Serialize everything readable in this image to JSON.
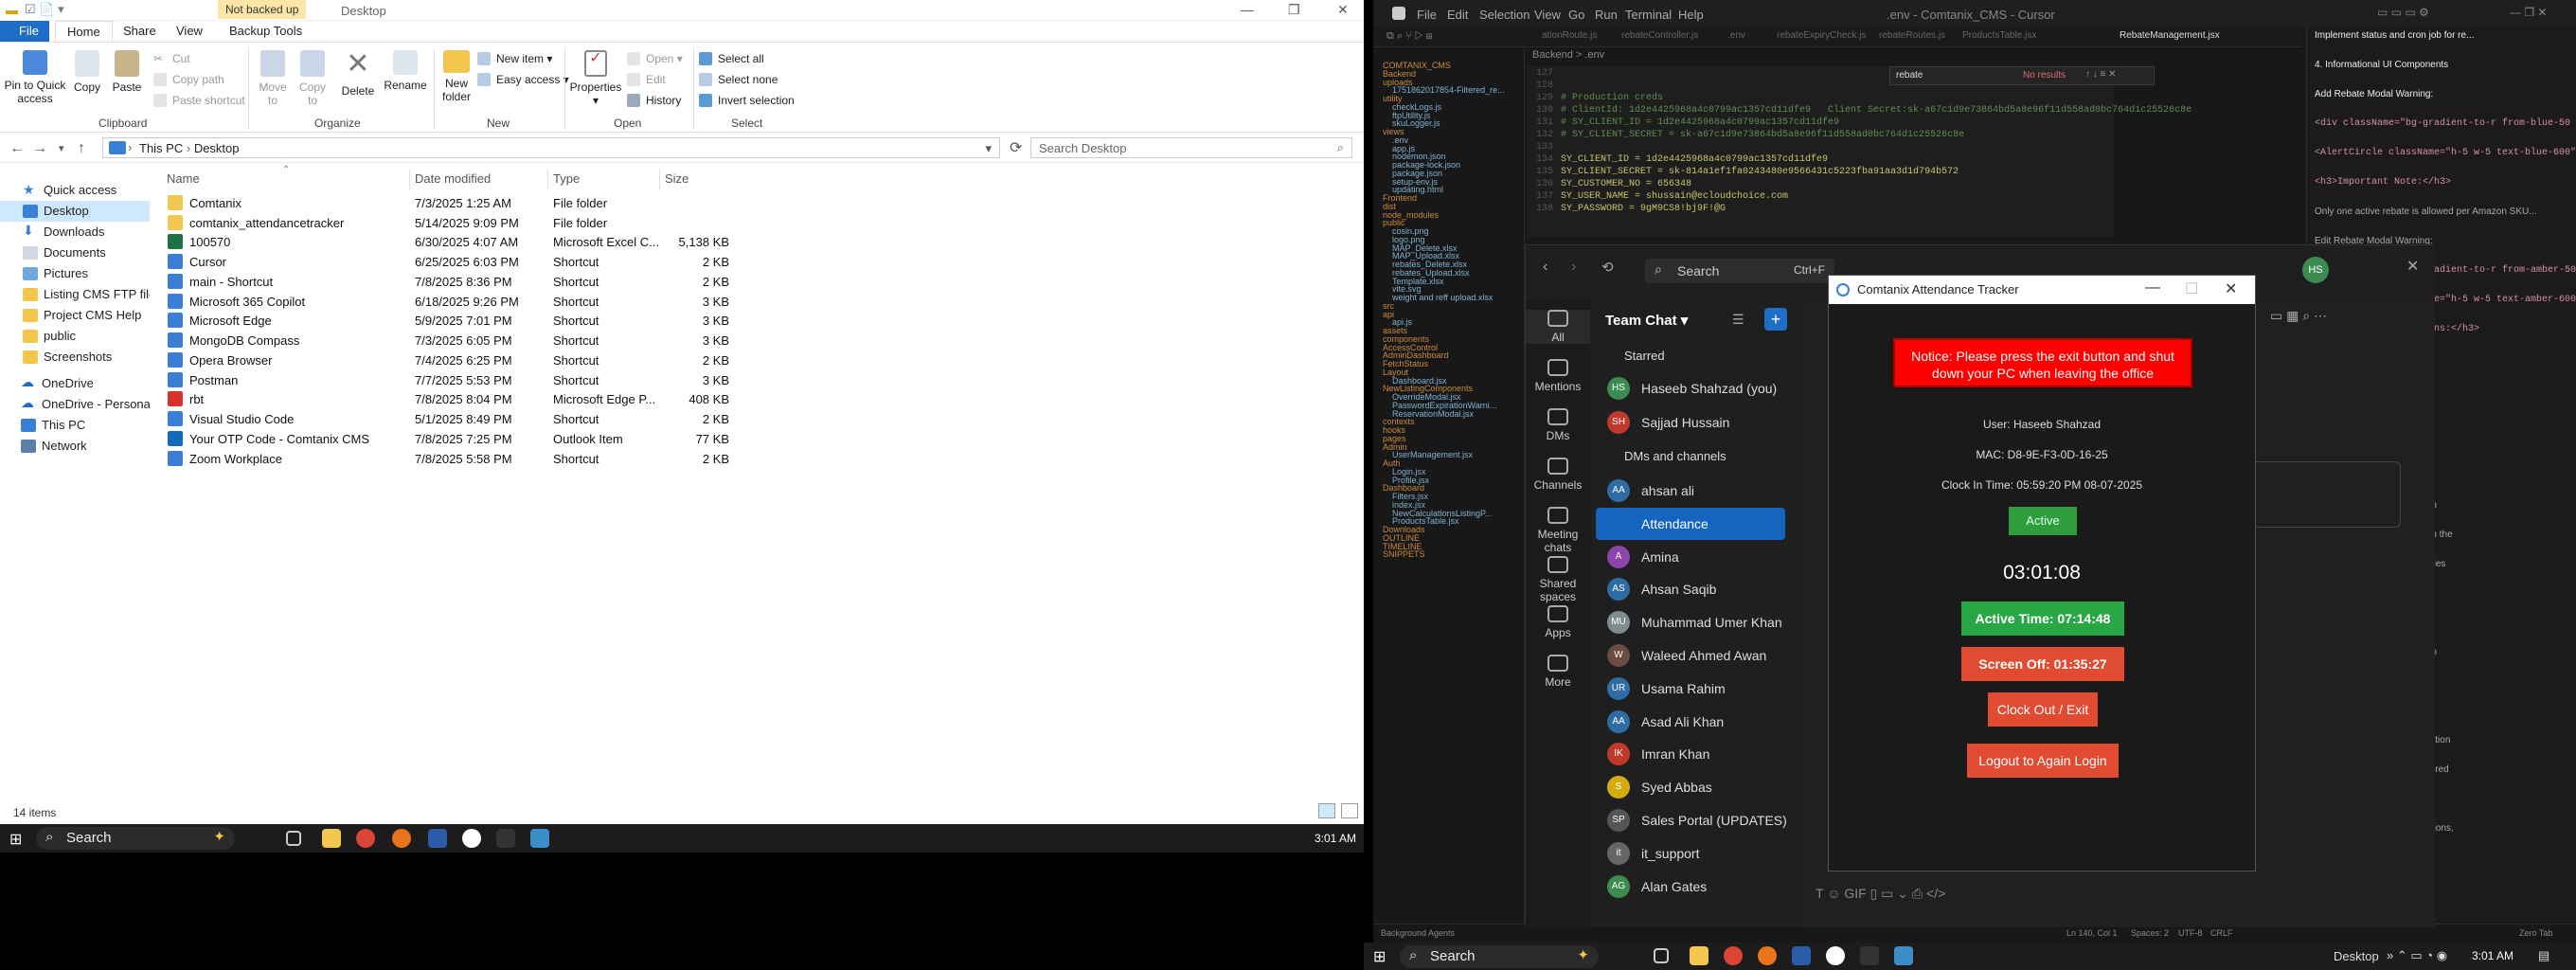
{
  "explorer": {
    "not_backed_up": "Not backed up",
    "title": "Desktop",
    "tabs": [
      "File",
      "Home",
      "Share",
      "View",
      "Backup Tools"
    ],
    "ribbon": {
      "pin": "Pin to Quick access",
      "copy": "Copy",
      "paste": "Paste",
      "cut": "Cut",
      "copy_path": "Copy path",
      "paste_shortcut": "Paste shortcut",
      "move_to": "Move to",
      "copy_to": "Copy to",
      "delete": "Delete",
      "rename": "Rename",
      "new_folder": "New folder",
      "new_item": "New item",
      "easy_access": "Easy access",
      "properties": "Properties",
      "open": "Open",
      "edit": "Edit",
      "history": "History",
      "select_all": "Select all",
      "select_none": "Select none",
      "invert_selection": "Invert selection",
      "groups": [
        "Clipboard",
        "Organize",
        "New",
        "Open",
        "Select"
      ]
    },
    "address": {
      "this_pc": "This PC",
      "desktop": "Desktop",
      "search_placeholder": "Search Desktop"
    },
    "nav": [
      "Quick access",
      "Desktop",
      "Downloads",
      "Documents",
      "Pictures",
      "Listing CMS FTP file",
      "Project CMS Help",
      "public",
      "Screenshots",
      "OneDrive",
      "OneDrive - Personal",
      "This PC",
      "Network"
    ],
    "columns": [
      "Name",
      "Date modified",
      "Type",
      "Size"
    ],
    "files": [
      {
        "name": "Comtanix",
        "date": "7/3/2025 1:25 AM",
        "type": "File folder",
        "size": ""
      },
      {
        "name": "comtanix_attendancetracker",
        "date": "5/14/2025 9:09 PM",
        "type": "File folder",
        "size": ""
      },
      {
        "name": "100570",
        "date": "6/30/2025 4:07 AM",
        "type": "Microsoft Excel C...",
        "size": "5,138 KB"
      },
      {
        "name": "Cursor",
        "date": "6/25/2025 6:03 PM",
        "type": "Shortcut",
        "size": "2 KB"
      },
      {
        "name": "main - Shortcut",
        "date": "7/8/2025 8:36 PM",
        "type": "Shortcut",
        "size": "2 KB"
      },
      {
        "name": "Microsoft 365 Copilot",
        "date": "6/18/2025 9:26 PM",
        "type": "Shortcut",
        "size": "3 KB"
      },
      {
        "name": "Microsoft Edge",
        "date": "5/9/2025 7:01 PM",
        "type": "Shortcut",
        "size": "3 KB"
      },
      {
        "name": "MongoDB Compass",
        "date": "7/3/2025 6:05 PM",
        "type": "Shortcut",
        "size": "3 KB"
      },
      {
        "name": "Opera Browser",
        "date": "7/4/2025 6:25 PM",
        "type": "Shortcut",
        "size": "2 KB"
      },
      {
        "name": "Postman",
        "date": "7/7/2025 5:53 PM",
        "type": "Shortcut",
        "size": "3 KB"
      },
      {
        "name": "rbt",
        "date": "7/8/2025 8:04 PM",
        "type": "Microsoft Edge P...",
        "size": "408 KB"
      },
      {
        "name": "Visual Studio Code",
        "date": "5/1/2025 8:49 PM",
        "type": "Shortcut",
        "size": "2 KB"
      },
      {
        "name": "Your OTP Code - Comtanix CMS",
        "date": "7/8/2025 7:25 PM",
        "type": "Outlook Item",
        "size": "77 KB"
      },
      {
        "name": "Zoom Workplace",
        "date": "7/8/2025 5:58 PM",
        "type": "Shortcut",
        "size": "2 KB"
      }
    ],
    "status": "14 items"
  },
  "taskbar_left": {
    "search": "Search",
    "time": "3:01 AM"
  },
  "ide": {
    "menu": [
      "File",
      "Edit",
      "Selection",
      "View",
      "Go",
      "Run",
      "Terminal",
      "Help"
    ],
    "title": ".env - Comtanix_CMS - Cursor",
    "tabs": [
      "ationRoute.js",
      "rebateController.js",
      ".env",
      "rebateExpiryCheck.js",
      "rebateRoutes.js",
      "ProductsTable.jsx",
      "RebateManagement.jsx"
    ],
    "breadcrumb": "Backend > .env",
    "find_text": "rebate",
    "find_result": "No results",
    "code": [
      {
        "n": "127",
        "t": ""
      },
      {
        "n": "128",
        "t": ""
      },
      {
        "n": "129",
        "t": "# Production creds"
      },
      {
        "n": "130",
        "t": "# ClientId: 1d2e4425968a4c0799ac1357cd11dfe9   Client Secret:sk-a67c1d9e73864bd5a8e96f11d558ad0bc764d1c25526c8e"
      },
      {
        "n": "131",
        "t": "# SY_CLIENT_ID = 1d2e4425968a4c0799ac1357cd11dfe9"
      },
      {
        "n": "132",
        "t": "# SY_CLIENT_SECRET = sk-a67c1d9e73864bd5a8e96f11d558ad0bc764d1c25526c8e"
      },
      {
        "n": "133",
        "t": ""
      },
      {
        "n": "134",
        "t": "SY_CLIENT_ID = 1d2e4425968a4c0799ac1357cd11dfe9"
      },
      {
        "n": "135",
        "t": "SY_CLIENT_SECRET = sk-814a1ef1fa0243480e9566431c5223fba91aa3d1d794b572"
      },
      {
        "n": "136",
        "t": "SY_CUSTOMER_NO = 656348"
      },
      {
        "n": "137",
        "t": "SY_USER_NAME = shussain@ecloudchoice.com"
      },
      {
        "n": "138",
        "t": "SY_PASSWORD = 9gM9CS8!bj9F!@G"
      }
    ],
    "tree": [
      "COMTANIX_CMS",
      "Backend",
      "uploads",
      "1751862017854-Filtered_re...",
      "utility",
      "checkLogs.js",
      "ftpUtility.js",
      "skuLogger.js",
      "views",
      ".env",
      "app.js",
      "nodemon.json",
      "package-lock.json",
      "package.json",
      "setup-env.js",
      "updating.html",
      "Frontend",
      "dist",
      "node_modules",
      "public",
      "cosin.png",
      "logo.png",
      "MAP_Delete.xlsx",
      "MAP_Upload.xlsx",
      "rebates_Delete.xlsx",
      "rebates_Upload.xlsx",
      "Template.xlsx",
      "vite.svg",
      "weight and reff upload.xlsx",
      "src",
      "api",
      "api.js",
      "assets",
      "components",
      "AccessControl",
      "AdminDashboard",
      "FetchStatus",
      "Layout",
      "Dashboard.jsx",
      "NewListingComponents",
      "OverrideModal.jsx",
      "PasswordExpirationWarni...",
      "ReservationModal.jsx",
      "contexts",
      "hooks",
      "pages",
      "Admin",
      "UserManagement.jsx",
      "Auth",
      "Login.jsx",
      "Profile.jsx",
      "Dashboard",
      "Filters.jsx",
      "index.jsx",
      "NewCalculationsListingP...",
      "ProductsTable.jsx",
      "Downloads",
      "OUTLINE",
      "TIMELINE",
      "SNIPPETS"
    ],
    "chat": [
      "Implement status and cron job for re...",
      "4. Informational UI Components",
      "Add Rebate Modal Warning:",
      "<div className=\"bg-gradient-to-r from-blue-50 to-indigo",
      "<AlertCircle className=\"h-5 w-5 text-blue-600\" />",
      "<h3>Important Note:</h3>",
      "Only one active rebate is allowed per Amazon SKU...",
      "Edit Rebate Modal Warning:",
      "<div className=\"bg-gradient-to-r from-amber-50 to-orang",
      "<AlertCircle className=\"h-5 w-5 text-amber-600\" />",
      "<h3>Update Restrictions:</h3>",
      "rebate's expiry date to e",
      "amber-50 rounded-lg border",
      "h-5 w-5 text-amber-600\" />",
      "SKUs that already have acti",
      "Improvements",
      "warned before they can even",
      "rebates are clearly marked in the",
      "sses explain the business rules",
      ", actionable error messages",
      "n errors use consistent red",
      "roducts with active rebates in",
      "in the main table",
      "and colored backgrounds",
      "with custom styling for validation",
      "for info, amber for warnings, red",
      "s understand the validation",
      "when they encounter restrictions,",
      "rocess smooth and intuitive.",
      "Management.jsx"
    ],
    "status": [
      "Background Agents",
      "Ln 140, Col 1",
      "Spaces: 2",
      "UTF-8",
      "CRLF",
      "Zero Tab"
    ]
  },
  "teams": {
    "search": "Search",
    "search_shortcut": "Ctrl+F",
    "rail": [
      "All",
      "Mentions",
      "DMs",
      "Channels",
      "Meeting chats",
      "Shared spaces",
      "Apps",
      "More"
    ],
    "header": "Team Chat",
    "starred": "Starred",
    "dms_channels": "DMs and channels",
    "starred_items": [
      {
        "initials": "HS",
        "name": "Haseeb Shahzad (you)",
        "color": "#3c8c52"
      },
      {
        "initials": "SH",
        "name": "Sajjad Hussain",
        "color": "#c0392b"
      }
    ],
    "items": [
      {
        "initials": "AA",
        "name": "ahsan ali",
        "color": "#2e6da4"
      },
      {
        "initials": "",
        "name": "Attendance",
        "color": "#1565c0"
      },
      {
        "initials": "A",
        "name": "Amina",
        "color": "#8e44ad"
      },
      {
        "initials": "AS",
        "name": "Ahsan Saqib",
        "color": "#2e6da4"
      },
      {
        "initials": "MU",
        "name": "Muhammad Umer Khan",
        "color": "#7f8c8d"
      },
      {
        "initials": "W",
        "name": "Waleed Ahmed Awan",
        "color": "#6d4c41"
      },
      {
        "initials": "UR",
        "name": "Usama Rahim",
        "color": "#2e6da4"
      },
      {
        "initials": "AA",
        "name": "Asad Ali Khan",
        "color": "#2e6da4"
      },
      {
        "initials": "IK",
        "name": "Imran Khan",
        "color": "#c0392b"
      },
      {
        "initials": "S",
        "name": "Syed Abbas",
        "color": "#d4ac0d"
      },
      {
        "initials": "SP",
        "name": "Sales Portal (UPDATES)",
        "color": "#555"
      },
      {
        "initials": "it",
        "name": "it_support",
        "color": "#666"
      },
      {
        "initials": "AG",
        "name": "Alan Gates",
        "color": "#3c8c52"
      }
    ]
  },
  "tracker": {
    "title": "Comtanix Attendance Tracker",
    "notice": "Notice: Please press the exit button and shut down your PC when leaving the office",
    "user": "User: Haseeb Shahzad",
    "mac": "MAC: D8-9E-F3-0D-16-25",
    "clock_in": "Clock In Time: 05:59:20 PM 08-07-2025",
    "status": "Active",
    "clock": "03:01:08",
    "active_time": "Active Time: 07:14:48",
    "screen_off": "Screen Off: 01:35:27",
    "clock_out": "Clock Out / Exit",
    "logout": "Logout to Again Login"
  },
  "taskbar_right": {
    "search": "Search",
    "desktop": "Desktop",
    "time": "3:01 AM"
  }
}
